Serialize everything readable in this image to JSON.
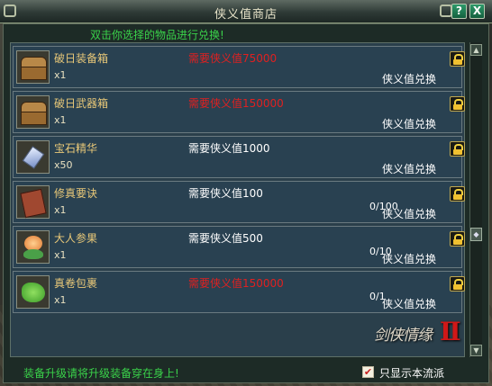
{
  "window": {
    "title": "侠义值商店",
    "help_label": "?",
    "close_label": "X",
    "hint": "双击你选择的物品进行兑换!"
  },
  "items": [
    {
      "name": "破日装备箱",
      "qty": "x1",
      "cost": "需要侠义值75000",
      "cost_color": "#e02020",
      "limit": "",
      "exchange": "侠义值兑换"
    },
    {
      "name": "破日武器箱",
      "qty": "x1",
      "cost": "需要侠义值150000",
      "cost_color": "#e02020",
      "limit": "",
      "exchange": "侠义值兑换"
    },
    {
      "name": "宝石精华",
      "qty": "x50",
      "cost": "需要侠义值1000",
      "cost_color": "#ffffff",
      "limit": "",
      "exchange": "侠义值兑换"
    },
    {
      "name": "修真要诀",
      "qty": "x1",
      "cost": "需要侠义值100",
      "cost_color": "#ffffff",
      "limit": "0/100",
      "exchange": "侠义值兑换"
    },
    {
      "name": "大人参果",
      "qty": "x1",
      "cost": "需要侠义值500",
      "cost_color": "#ffffff",
      "limit": "0/10",
      "exchange": "侠义值兑换"
    },
    {
      "name": "真卷包裹",
      "qty": "x1",
      "cost": "需要侠义值150000",
      "cost_color": "#e02020",
      "limit": "0/1",
      "exchange": "侠义值兑换"
    }
  ],
  "icons": [
    "chest-icon",
    "chest-icon",
    "gem-icon",
    "book-icon",
    "ginseng-fruit-icon",
    "herb-bundle-icon"
  ],
  "logo": {
    "text": "剑侠情缘",
    "roman": "Ⅱ"
  },
  "footer": {
    "tip": "装备升级请将升级装备穿在身上!",
    "checkbox_label": "只显示本流派",
    "checkbox_checked": true
  }
}
